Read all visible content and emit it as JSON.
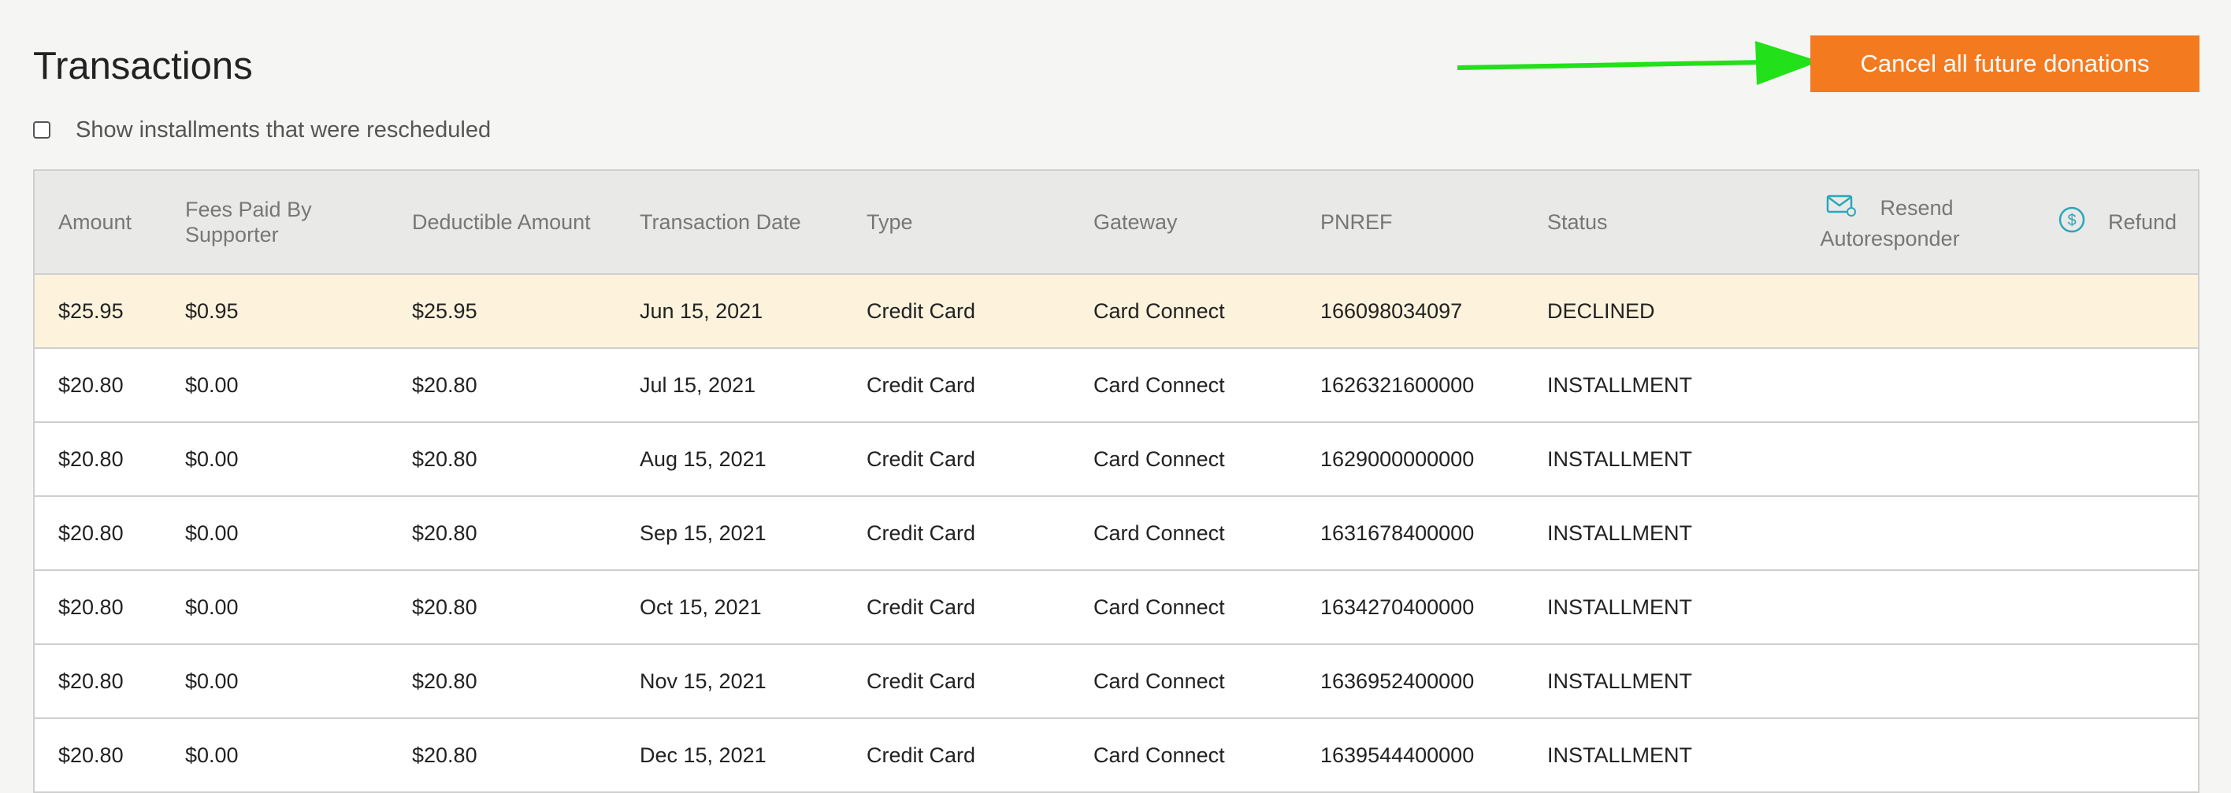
{
  "page": {
    "title": "Transactions",
    "cancel_button": "Cancel all future donations",
    "show_rescheduled_label": "Show installments that were rescheduled"
  },
  "colors": {
    "accent_orange": "#f47a20",
    "arrow_green": "#22e01a",
    "highlight_row": "#fdf3dc",
    "icon_teal": "#2aa7b8"
  },
  "table": {
    "headers": {
      "amount": "Amount",
      "fees_line1": "Fees Paid By",
      "fees_line2": "Supporter",
      "deductible": "Deductible Amount",
      "date": "Transaction Date",
      "type": "Type",
      "gateway": "Gateway",
      "pnref": "PNREF",
      "status": "Status",
      "resend_line1": "Resend",
      "resend_line2": "Autoresponder",
      "refund": "Refund"
    },
    "rows": [
      {
        "amount": "$25.95",
        "fees": "$0.95",
        "deductible": "$25.95",
        "date": "Jun 15, 2021",
        "type": "Credit Card",
        "gateway": "Card Connect",
        "pnref": "166098034097",
        "status": "DECLINED"
      },
      {
        "amount": "$20.80",
        "fees": "$0.00",
        "deductible": "$20.80",
        "date": "Jul 15, 2021",
        "type": "Credit Card",
        "gateway": "Card Connect",
        "pnref": "1626321600000",
        "status": "INSTALLMENT"
      },
      {
        "amount": "$20.80",
        "fees": "$0.00",
        "deductible": "$20.80",
        "date": "Aug 15, 2021",
        "type": "Credit Card",
        "gateway": "Card Connect",
        "pnref": "1629000000000",
        "status": "INSTALLMENT"
      },
      {
        "amount": "$20.80",
        "fees": "$0.00",
        "deductible": "$20.80",
        "date": "Sep 15, 2021",
        "type": "Credit Card",
        "gateway": "Card Connect",
        "pnref": "1631678400000",
        "status": "INSTALLMENT"
      },
      {
        "amount": "$20.80",
        "fees": "$0.00",
        "deductible": "$20.80",
        "date": "Oct 15, 2021",
        "type": "Credit Card",
        "gateway": "Card Connect",
        "pnref": "1634270400000",
        "status": "INSTALLMENT"
      },
      {
        "amount": "$20.80",
        "fees": "$0.00",
        "deductible": "$20.80",
        "date": "Nov 15, 2021",
        "type": "Credit Card",
        "gateway": "Card Connect",
        "pnref": "1636952400000",
        "status": "INSTALLMENT"
      },
      {
        "amount": "$20.80",
        "fees": "$0.00",
        "deductible": "$20.80",
        "date": "Dec 15, 2021",
        "type": "Credit Card",
        "gateway": "Card Connect",
        "pnref": "1639544400000",
        "status": "INSTALLMENT"
      }
    ]
  },
  "icons": {
    "resend": "envelope-icon",
    "refund": "dollar-circle-icon",
    "annotation": "green-arrow"
  }
}
